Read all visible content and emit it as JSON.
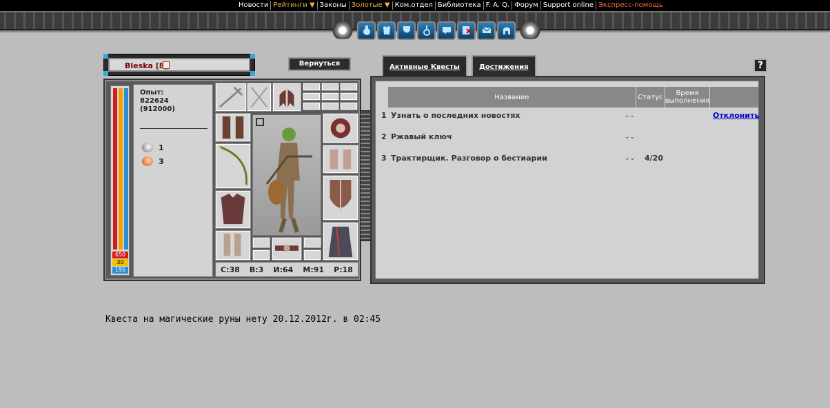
{
  "nav": {
    "items": [
      {
        "label": "Новости",
        "style": "normal"
      },
      {
        "label": "Рейтинги ▼",
        "style": "gold"
      },
      {
        "label": "Законы",
        "style": "normal"
      },
      {
        "label": "Золотые ▼",
        "style": "gold"
      },
      {
        "label": "Ком.отдел",
        "style": "normal"
      },
      {
        "label": "Библиотека",
        "style": "normal"
      },
      {
        "label": "F. A. Q.",
        "style": "normal"
      },
      {
        "label": "Форум",
        "style": "normal"
      },
      {
        "label": "Support online",
        "style": "normal"
      },
      {
        "label": "Экспресс-помощь",
        "style": "red"
      }
    ]
  },
  "iconbar": {
    "icons": [
      "potion-icon",
      "armor-icon",
      "shield-icon",
      "key-icon",
      "chat-icon",
      "exit-icon",
      "mail-icon",
      "castle-icon"
    ]
  },
  "character": {
    "name": "Bleska [8]",
    "back_label": "Вернуться",
    "exp_label": "Опыт:",
    "exp_value": "822624",
    "exp_next": "(912000)",
    "resources": [
      {
        "count": "1",
        "color": "#e8e8e8",
        "icon": "silver-coin-icon"
      },
      {
        "count": "3",
        "color": "#e98a4a",
        "icon": "copper-coin-icon"
      }
    ],
    "bars": {
      "hp": "650",
      "stamina": "30",
      "mana": "195"
    },
    "attributes": [
      {
        "label": "С:38"
      },
      {
        "label": "В:3"
      },
      {
        "label": "И:64"
      },
      {
        "label": "М:91"
      },
      {
        "label": "Р:18"
      }
    ]
  },
  "tabs": [
    {
      "label": "Активные Квесты",
      "active": true
    },
    {
      "label": "Достижения",
      "active": false
    }
  ],
  "help_label": "?",
  "quests": {
    "headers": {
      "name": "Название",
      "status": "Статус",
      "time": "Время выполнения"
    },
    "rows": [
      {
        "num": "1",
        "title": "Узнать о последних новостях",
        "status": "",
        "action": "Отклонить"
      },
      {
        "num": "2",
        "title": "Ржавый ключ",
        "status": "",
        "action": ""
      },
      {
        "num": "3",
        "title": "Трактирщик. Разговор о бестиарии",
        "status": "4/20",
        "action": ""
      }
    ]
  },
  "footer_message": "Квеста на магические руны нету 20.12.2012г. в 02:45"
}
